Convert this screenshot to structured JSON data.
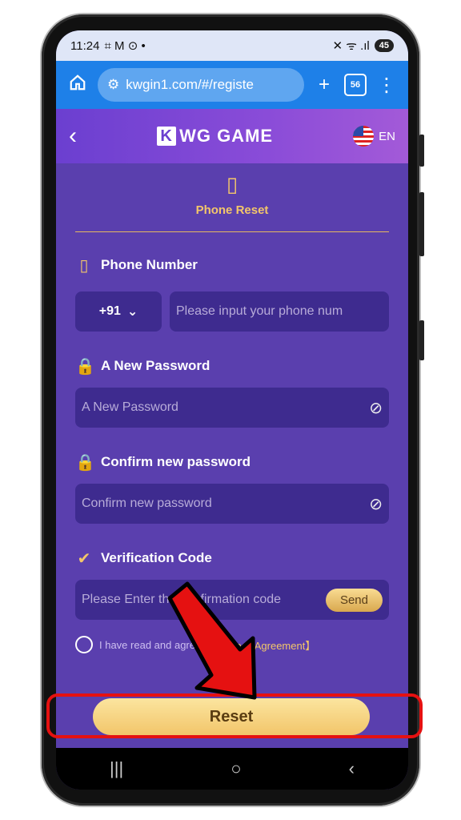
{
  "statusbar": {
    "time": "11:24",
    "left_icons": "⌗ M ⊙ •",
    "right_icons": "✕ ᯤ .ıl",
    "battery": "45"
  },
  "browser": {
    "url": "kwgin1.com/#/registe",
    "tabs_count": "56",
    "home_icon": "home-icon",
    "plus_label": "+",
    "menu_label": "⋮"
  },
  "header": {
    "logo_letter": "K",
    "logo_text": "WG GAME",
    "lang": "EN",
    "back": "‹"
  },
  "page": {
    "heading": "Phone Reset",
    "phone_label": "Phone Number",
    "country_code": "+91",
    "phone_placeholder": "Please input your phone num",
    "new_pw_label": "A New Password",
    "new_pw_placeholder": "A New Password",
    "confirm_label": "Confirm new password",
    "confirm_placeholder": "Confirm new password",
    "code_label": "Verification Code",
    "code_placeholder": "Please Enter the confirmation code",
    "send": "Send",
    "agree_prefix": "I have read and agree",
    "agree_link": "【Privacy Agreement】",
    "reset": "Reset"
  },
  "navbar": {
    "recents": "|||",
    "home": "○",
    "back": "‹"
  },
  "colors": {
    "background": "#5a3fae",
    "field": "#3e2b8f",
    "accent": "#f3c66a",
    "highlight": "#e51111"
  }
}
